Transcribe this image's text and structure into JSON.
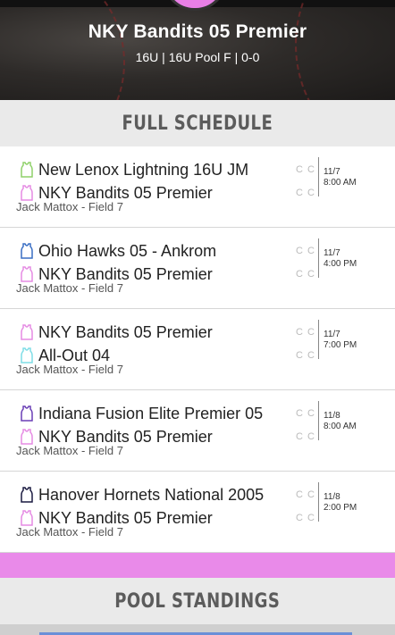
{
  "header": {
    "team_name": "NKY Bandits 05 Premier",
    "subtitle": "16U | 16U Pool F | 0-0"
  },
  "sections": {
    "schedule_title": "FULL SCHEDULE",
    "standings_title": "POOL STANDINGS"
  },
  "games": [
    {
      "team1": {
        "name": "New Lenox Lightning 16U JM",
        "jersey_color": "#8fd16a",
        "score": "C C"
      },
      "team2": {
        "name": "NKY Bandits 05 Premier",
        "jersey_color": "#e58be3",
        "score": "C C"
      },
      "venue": "Jack Mattox - Field 7",
      "date": "11/7",
      "time": "8:00 AM"
    },
    {
      "team1": {
        "name": "Ohio Hawks 05 - Ankrom",
        "jersey_color": "#3a6fc4",
        "score": "C C"
      },
      "team2": {
        "name": "NKY Bandits 05 Premier",
        "jersey_color": "#e58be3",
        "score": "C C"
      },
      "venue": "Jack Mattox - Field 7",
      "date": "11/7",
      "time": "4:00 PM"
    },
    {
      "team1": {
        "name": "NKY Bandits 05 Premier",
        "jersey_color": "#e58be3",
        "score": "C C"
      },
      "team2": {
        "name": "All-Out 04",
        "jersey_color": "#7fdde6",
        "score": "C C"
      },
      "venue": "Jack Mattox - Field 7",
      "date": "11/7",
      "time": "7:00 PM"
    },
    {
      "team1": {
        "name": "Indiana Fusion Elite Premier 05",
        "jersey_color": "#6a3fb5",
        "score": "C C"
      },
      "team2": {
        "name": "NKY Bandits 05 Premier",
        "jersey_color": "#e58be3",
        "score": "C C"
      },
      "venue": "Jack Mattox - Field 7",
      "date": "11/8",
      "time": "8:00 AM"
    },
    {
      "team1": {
        "name": "Hanover Hornets National 2005",
        "jersey_color": "#1a1a40",
        "score": "C C"
      },
      "team2": {
        "name": "NKY Bandits 05 Premier",
        "jersey_color": "#e58be3",
        "score": "C C"
      },
      "venue": "Jack Mattox - Field 7",
      "date": "11/8",
      "time": "2:00 PM"
    }
  ],
  "colors": {
    "accent_pink": "#e98ae9",
    "section_bg": "#eaeaea"
  }
}
